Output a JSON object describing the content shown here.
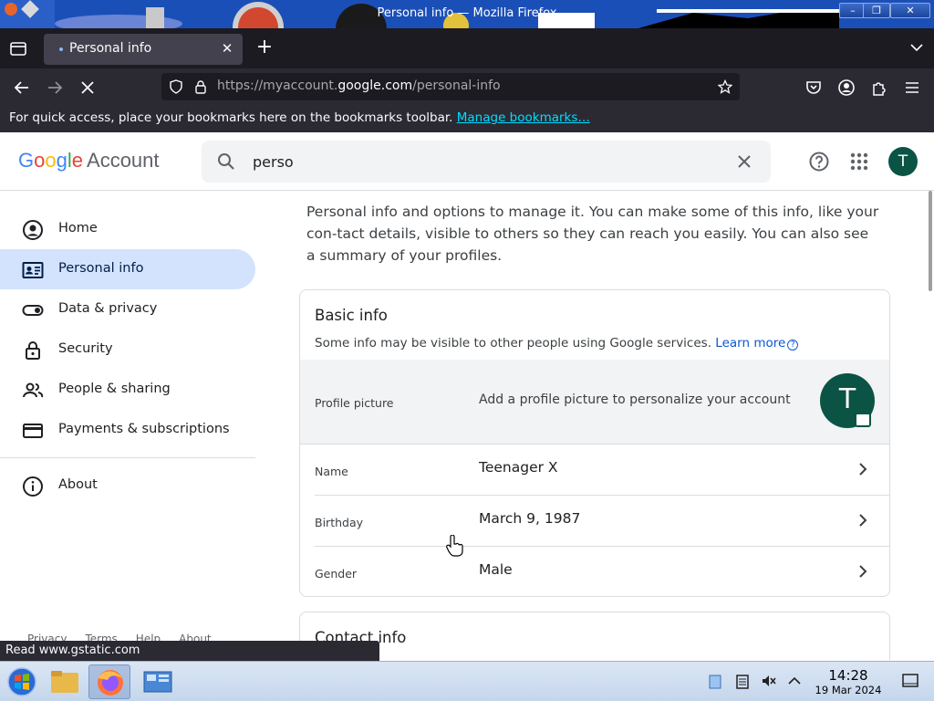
{
  "window": {
    "title": "Personal info — Mozilla Firefox"
  },
  "browser": {
    "tab_label": "Personal info",
    "url_prefix": "https://myaccount.",
    "url_domain": "google.com",
    "url_path": "/personal-info",
    "bookmarks_text": "For quick access, place your bookmarks here on the bookmarks toolbar.",
    "bookmarks_link": "Manage bookmarks…"
  },
  "header": {
    "logo": {
      "g": "G",
      "o1": "o",
      "o2": "o",
      "g2": "g",
      "l": "l",
      "e": "e"
    },
    "account_label": "Account",
    "search_value": "perso",
    "avatar_letter": "T"
  },
  "sidebar": {
    "items": [
      {
        "label": "Home",
        "icon": "account-circle-icon"
      },
      {
        "label": "Personal info",
        "icon": "id-card-icon",
        "active": true
      },
      {
        "label": "Data & privacy",
        "icon": "toggle-icon"
      },
      {
        "label": "Security",
        "icon": "lock-icon"
      },
      {
        "label": "People & sharing",
        "icon": "people-icon"
      },
      {
        "label": "Payments & subscriptions",
        "icon": "credit-card-icon"
      }
    ],
    "about": "About",
    "footer": [
      "Privacy",
      "Terms",
      "Help",
      "About"
    ]
  },
  "main": {
    "intro": "Personal info and options to manage it. You can make some of this info, like your con-tact details, visible to others so they can reach you easily. You can also see a summary of your profiles.",
    "basic_info": {
      "title": "Basic info",
      "subtitle": "Some info may be visible to other people using Google services.",
      "learn_more": "Learn more",
      "profile_picture_label": "Profile picture",
      "profile_picture_text": "Add a profile picture to personalize your account",
      "avatar_letter": "T",
      "rows": [
        {
          "label": "Name",
          "value": "Teenager X"
        },
        {
          "label": "Birthday",
          "value": "March 9, 1987"
        },
        {
          "label": "Gender",
          "value": "Male"
        }
      ]
    },
    "contact_info_title": "Contact info"
  },
  "status_bar": "Read www.gstatic.com",
  "taskbar": {
    "time": "14:28",
    "date": "19 Mar 2024"
  },
  "colors": {
    "accent": "#0b57d0",
    "active_nav": "#d3e3fd",
    "avatar": "#0b5345"
  }
}
